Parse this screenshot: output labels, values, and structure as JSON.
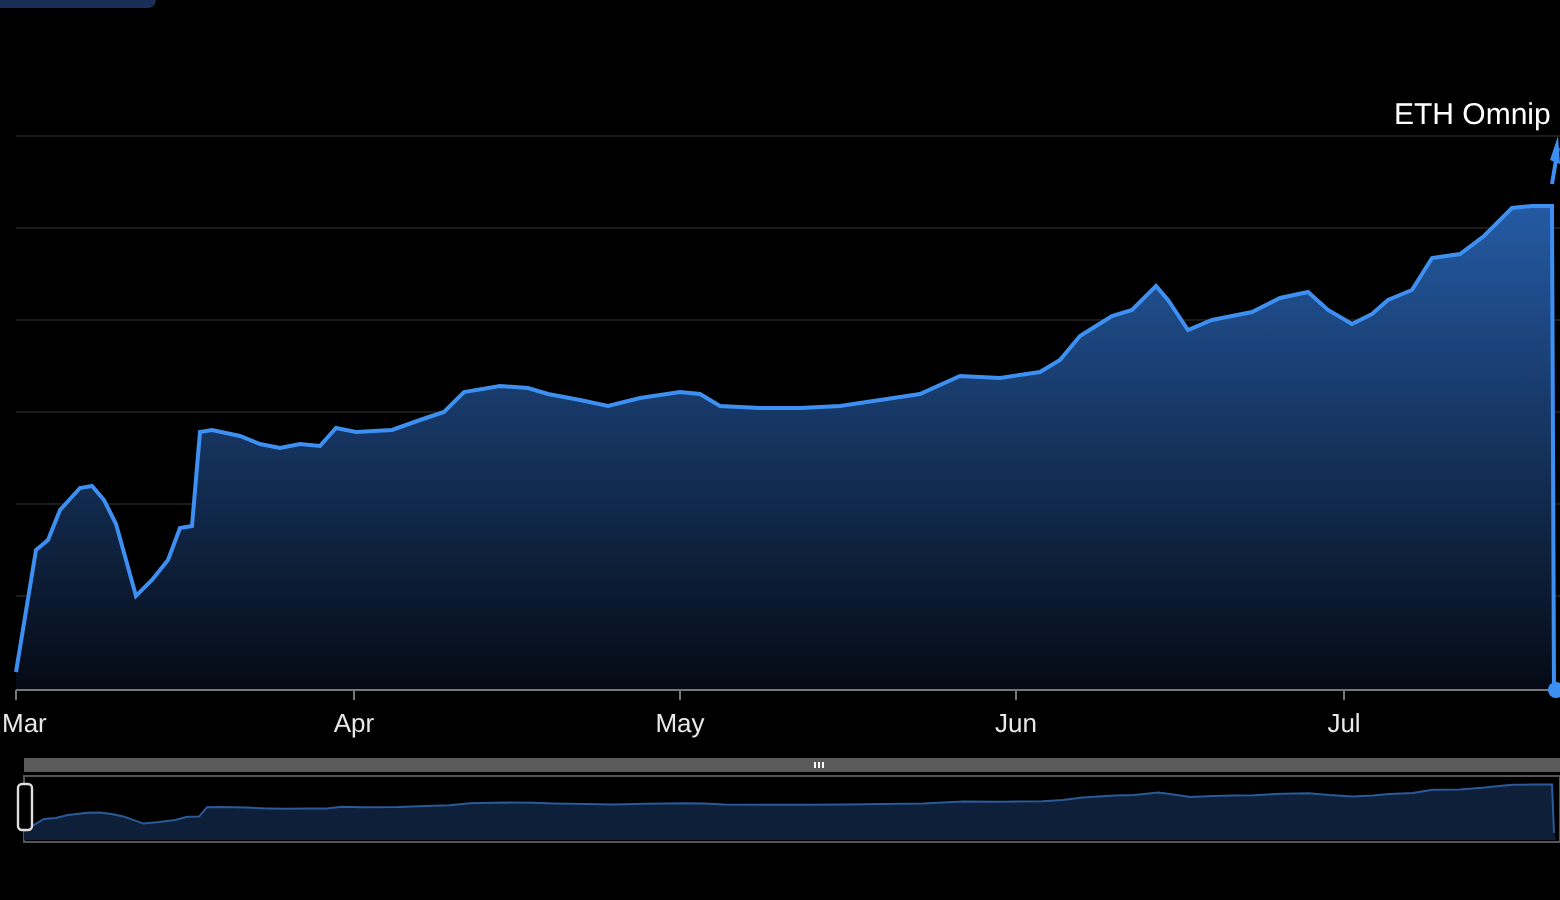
{
  "chart": {
    "annotation": {
      "label": "ETH Omnip"
    },
    "x_axis_labels": [
      "Mar",
      "Apr",
      "May",
      "Jun",
      "Jul"
    ]
  },
  "range_slider": {
    "kind": "brush"
  }
}
